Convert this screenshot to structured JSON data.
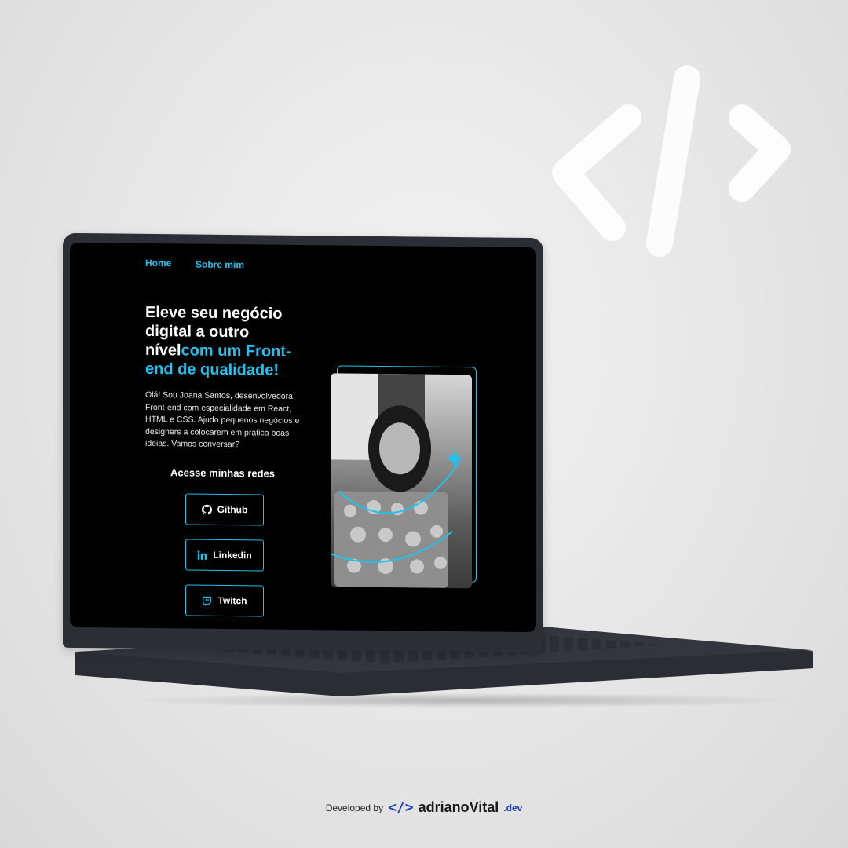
{
  "nav": {
    "home": "Home",
    "about": "Sobre mim"
  },
  "hero": {
    "headline_white": "Eleve seu negócio digital a outro nível",
    "headline_accent": "com um Front-end de qualidade!",
    "intro": "Olá! Sou Joana Santos, desenvolvedora Front-end com especialidade em React, HTML e CSS. Ajudo pequenos negócios e designers a colocarem em prática boas ideias. Vamos conversar?"
  },
  "social": {
    "title": "Acesse minhas redes",
    "buttons": [
      {
        "label": "Github",
        "icon": "github-icon"
      },
      {
        "label": "Linkedin",
        "icon": "linkedin-icon"
      },
      {
        "label": "Twitch",
        "icon": "twitch-icon"
      }
    ]
  },
  "credit": {
    "prefix": "Developed by",
    "glyph": "</>",
    "brand": "adrianoVital",
    "tld": ".dev"
  },
  "colors": {
    "accent": "#1ec3f0",
    "screen_bg": "#000000",
    "laptop_body": "#2b2e34",
    "brand_blue": "#1f3fbf"
  }
}
